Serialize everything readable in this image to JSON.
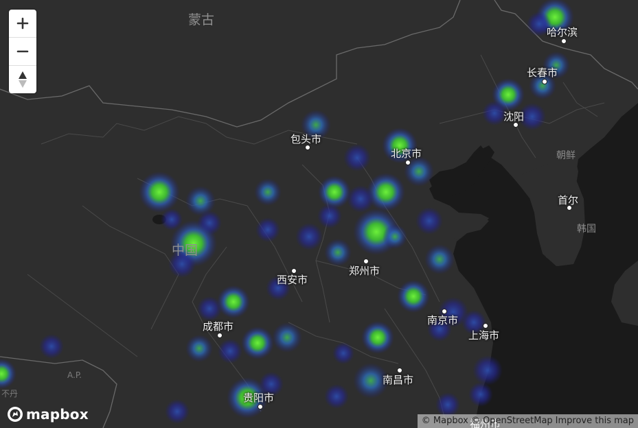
{
  "map": {
    "labels": {
      "mongolia": "蒙古",
      "harbin": "哈尔滨",
      "changchun": "长春市",
      "shenyang": "沈阳",
      "north_korea": "朝鲜",
      "seoul": "首尔",
      "south_korea": "韩国",
      "baotou": "包头市",
      "beijing": "北京市",
      "china": "中国",
      "xian": "西安市",
      "zhengzhou": "郑州市",
      "nanjing": "南京市",
      "shanghai": "上海市",
      "chengdu": "成都市",
      "guiyang": "贵阳市",
      "nanchang": "南昌市",
      "ap": "A.P.",
      "bhutan": "不丹",
      "bottom_partial": "福州市"
    },
    "heatmap_colors": {
      "low": "#2a2ea8",
      "mid": "#3b6fc0",
      "high": "#4ad11e",
      "core": "#7cf23a"
    }
  },
  "controls": {
    "zoom_in": "+",
    "zoom_out": "−",
    "compass": "north-arrow-icon"
  },
  "branding": {
    "logo_text": "mapbox"
  },
  "attribution": {
    "mapbox": "© Mapbox",
    "osm": "© OpenStreetMap",
    "improve": "Improve this map"
  }
}
